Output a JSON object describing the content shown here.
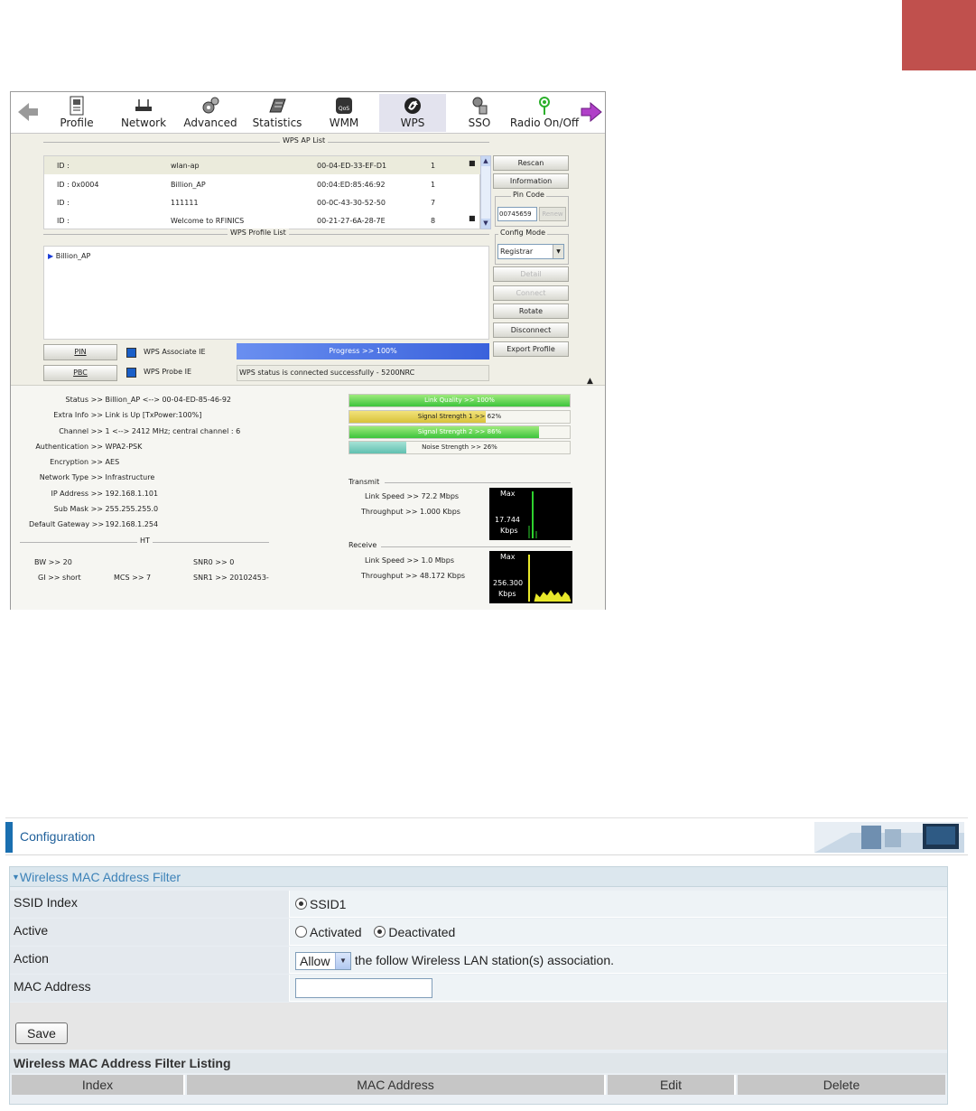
{
  "top_screenshot": {
    "toolbar": [
      "Profile",
      "Network",
      "Advanced",
      "Statistics",
      "WMM",
      "WPS",
      "SSO",
      "Radio On/Off"
    ],
    "selected_tab": "WPS",
    "ap_list_title": "WPS AP List",
    "ap_list": [
      {
        "id": "ID :",
        "ssid": "wlan-ap",
        "mac": "00-04-ED-33-EF-D1",
        "ch": "1"
      },
      {
        "id": "ID : 0x0004",
        "ssid": "Billion_AP",
        "mac": "00:04:ED:85:46:92",
        "ch": "1"
      },
      {
        "id": "ID :",
        "ssid": "111111",
        "mac": "00-0C-43-30-52-50",
        "ch": "7"
      },
      {
        "id": "ID :",
        "ssid": "Welcome to RFINICS",
        "mac": "00-21-27-6A-28-7E",
        "ch": "8"
      }
    ],
    "buttons": {
      "rescan": "Rescan",
      "information": "Information",
      "renew": "Renew",
      "detail": "Detail",
      "connect": "Connect",
      "rotate": "Rotate",
      "disconnect": "Disconnect",
      "export": "Export Profile",
      "pin": "PIN",
      "pbc": "PBC"
    },
    "pin_code_label": "Pin Code",
    "pin_code": "00745659",
    "config_mode_label": "Config Mode",
    "config_mode": "Registrar",
    "profile_list_title": "WPS Profile List",
    "profile": "Billion_AP",
    "wps_associate_ie": "WPS Associate IE",
    "wps_probe_ie": "WPS Probe IE",
    "progress_text": "Progress >> 100%",
    "progress_value": 100,
    "wps_status": "WPS status is connected successfully - 5200NRC",
    "status": [
      {
        "k": "Status >>",
        "v": "Billion_AP <--> 00-04-ED-85-46-92"
      },
      {
        "k": "Extra Info >>",
        "v": "Link is Up [TxPower:100%]"
      },
      {
        "k": "Channel >>",
        "v": "1 <--> 2412 MHz; central channel : 6"
      },
      {
        "k": "Authentication >>",
        "v": "WPA2-PSK"
      },
      {
        "k": "Encryption >>",
        "v": "AES"
      },
      {
        "k": "Network Type >>",
        "v": "Infrastructure"
      },
      {
        "k": "IP Address >>",
        "v": "192.168.1.101"
      },
      {
        "k": "Sub Mask >>",
        "v": "255.255.255.0"
      },
      {
        "k": "Default Gateway >>",
        "v": "192.168.1.254"
      }
    ],
    "ht_label": "HT",
    "ht": {
      "bw": "BW >> 20",
      "gi": "GI >> short",
      "mcs": "MCS >> 7",
      "snr0": "SNR0 >> 0",
      "snr1": "SNR1 >> 20102453-"
    },
    "signal": [
      {
        "label": "Link Quality >> 100%",
        "value": 100
      },
      {
        "label": "Signal Strength 1 >> 62%",
        "value": 62
      },
      {
        "label": "Signal Strength 2 >> 86%",
        "value": 86
      },
      {
        "label": "Noise Strength >> 26%",
        "value": 26
      }
    ],
    "transmit_label": "Transmit",
    "transmit": {
      "link_speed": "Link Speed >> 72.2 Mbps",
      "throughput": "Throughput >> 1.000 Kbps",
      "graph_max": "Max",
      "graph_value": "17.744",
      "graph_unit": "Kbps"
    },
    "receive_label": "Receive",
    "receive": {
      "link_speed": "Link Speed >> 1.0 Mbps",
      "throughput": "Throughput >> 48.172 Kbps",
      "graph_max": "Max",
      "graph_value": "256.300",
      "graph_unit": "Kbps"
    }
  },
  "config": {
    "title": "Configuration",
    "section_title": "Wireless MAC Address Filter",
    "ssid_index_label": "SSID Index",
    "ssid_option": "SSID1",
    "active_label": "Active",
    "activated": "Activated",
    "deactivated": "Deactivated",
    "action_label": "Action",
    "action_value": "Allow",
    "action_text": "the follow Wireless LAN station(s) association.",
    "mac_label": "MAC Address",
    "mac_value": "",
    "save": "Save",
    "listing_title": "Wireless MAC Address Filter Listing",
    "columns": [
      "Index",
      "MAC Address",
      "Edit",
      "Delete"
    ]
  },
  "colors": {
    "accent": "#1a6fb0",
    "corner": "#c0504d",
    "link_blue": "#3c82b8"
  }
}
